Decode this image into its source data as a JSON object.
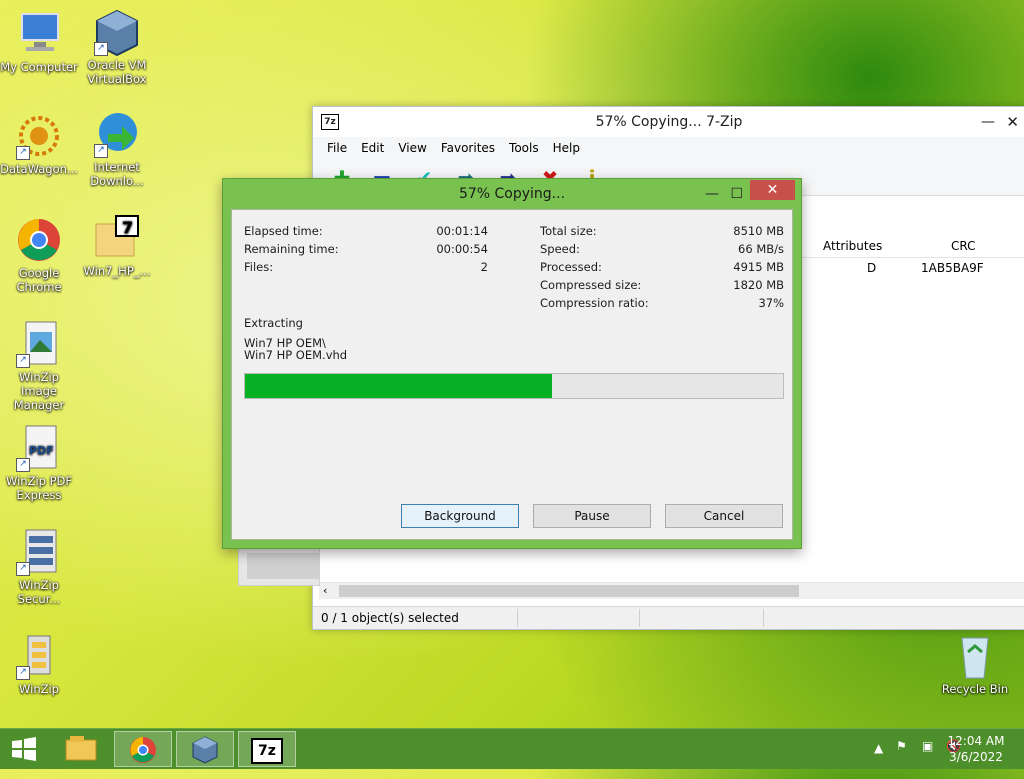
{
  "desktop": {
    "icons": [
      {
        "label": "My Computer",
        "icon": "computer-icon"
      },
      {
        "label": "Oracle VM VirtualBox",
        "icon": "virtualbox-icon"
      },
      {
        "label": "DataWagon...",
        "icon": "datawagon-icon"
      },
      {
        "label": "Internet Downlo...",
        "icon": "internet-download-manager-icon"
      },
      {
        "label": "Google Chrome",
        "icon": "chrome-icon"
      },
      {
        "label": "Win7_HP_...",
        "icon": "7zip-archive-icon"
      },
      {
        "label": "WinZip Image Manager",
        "icon": "winzip-image-manager-icon"
      },
      {
        "label": "WinZip PDF Express",
        "icon": "winzip-pdf-express-icon"
      },
      {
        "label": "WinZip Secur...",
        "icon": "winzip-secure-icon"
      },
      {
        "label": "WinZip",
        "icon": "winzip-icon"
      },
      {
        "label": "Recycle Bin",
        "icon": "recycle-bin-icon"
      }
    ]
  },
  "main_window": {
    "title": "57% Copying... 7-Zip",
    "app_icon_text": "7z",
    "menu": [
      "File",
      "Edit",
      "View",
      "Favorites",
      "Tools",
      "Help"
    ],
    "columns": [
      "Attributes",
      "CRC"
    ],
    "row": {
      "attributes": "D",
      "crc": "1AB5BA9F"
    },
    "status": "0 / 1 object(s) selected"
  },
  "dialog": {
    "title": "57% Copying...",
    "left_stats": [
      {
        "label": "Elapsed time:",
        "value": "00:01:14"
      },
      {
        "label": "Remaining time:",
        "value": "00:00:54"
      },
      {
        "label": "Files:",
        "value": "2"
      }
    ],
    "right_stats": [
      {
        "label": "Total size:",
        "value": "8510 MB"
      },
      {
        "label": "Speed:",
        "value": "66 MB/s"
      },
      {
        "label": "Processed:",
        "value": "4915 MB"
      },
      {
        "label": "Compressed size:",
        "value": "1820 MB"
      },
      {
        "label": "Compression ratio:",
        "value": "37%"
      }
    ],
    "action": "Extracting",
    "path1": "Win7 HP OEM\\",
    "path2": "Win7 HP OEM.vhd",
    "progress_percent": 57,
    "buttons": {
      "background": "Background",
      "pause": "Pause",
      "cancel": "Cancel"
    }
  },
  "taskbar": {
    "items": [
      "windows-start-icon",
      "file-explorer-icon",
      "chrome-icon",
      "virtualbox-icon",
      "7zip-icon"
    ],
    "app_7z_text": "7z",
    "time": "12:04 AM",
    "date": "3/6/2022"
  }
}
